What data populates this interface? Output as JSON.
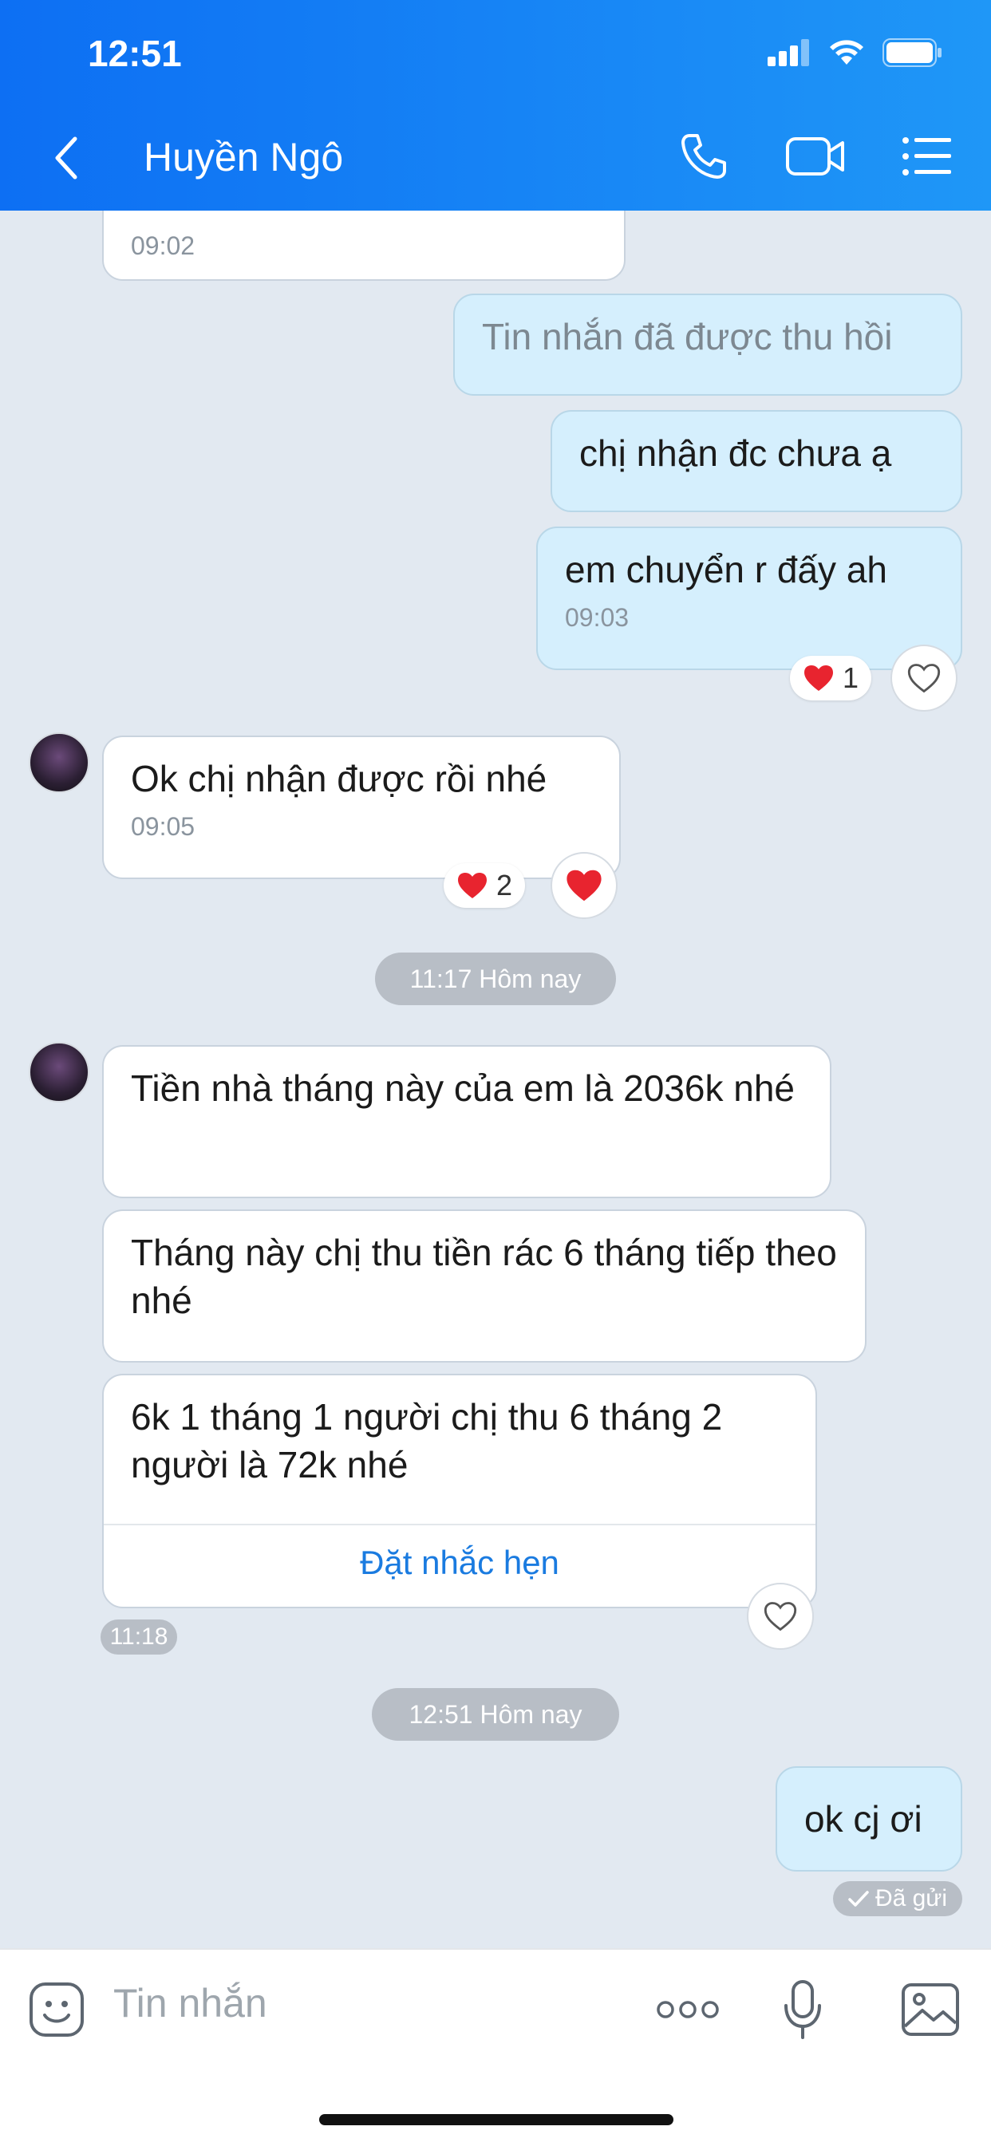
{
  "status_bar": {
    "time": "12:51"
  },
  "header": {
    "title": "Huyền Ngô"
  },
  "messages": {
    "m0_time": "09:02",
    "m1_text": "Tin nhắn đã được thu hồi",
    "m2_text": "chị nhận đc chưa ạ",
    "m3_text": "em chuyển r đấy ah",
    "m3_time": "09:03",
    "m3_reaction_count": "1",
    "m4_text": "Ok chị nhận được rồi nhé",
    "m4_time": "09:05",
    "m4_reaction_count": "2",
    "divider1": "11:17 Hôm nay",
    "m5_text": " Tiền nhà tháng này của em là 2036k nhé",
    "m6_text": "Tháng này chị thu tiền rác 6 tháng tiếp theo nhé",
    "m7_text": "6k 1 tháng 1 người chị thu 6 tháng 2 người là 72k nhé",
    "m7_reminder": "Đặt nhắc hẹn",
    "m7_time": "11:18",
    "divider2": "12:51 Hôm nay",
    "m8_text": "ok cj ơi",
    "m8_status": "Đã gửi"
  },
  "input": {
    "placeholder": "Tin nhắn"
  },
  "colors": {
    "header_start": "#0d6ff3",
    "header_end": "#1f97f7",
    "outgoing_bubble": "#d5effd",
    "chat_bg": "#e2e9f1",
    "heart": "#e8242f"
  },
  "icons": [
    "back-icon",
    "phone-icon",
    "video-call-icon",
    "menu-list-icon",
    "sticker-icon",
    "more-icon",
    "microphone-icon",
    "image-icon",
    "heart-icon",
    "heart-outline-icon",
    "check-icon",
    "signal-icon",
    "wifi-icon",
    "battery-icon"
  ]
}
